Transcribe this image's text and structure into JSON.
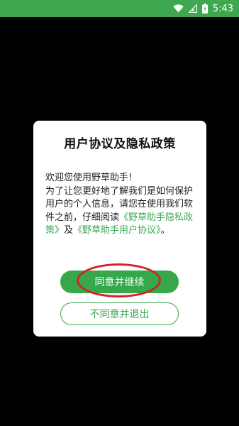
{
  "status_bar": {
    "time": "5:43",
    "wifi_icon": "wifi-icon",
    "signal_icon": "cell-signal-icon",
    "battery_icon": "battery-charging-icon",
    "background_color": "#3da84f"
  },
  "dialog": {
    "title": "用户协议及隐私政策",
    "welcome": "欢迎您使用野草助手!",
    "body_text": "为了让您更好地了解我们是如何保护用户的个人信息，请您在使用我们软件之前，仔细阅读",
    "privacy_link": "《野草助手隐私政策》",
    "and_text": "及",
    "agreement_link": "《野草助手用户协议》",
    "end_punct": "。",
    "agree_label": "同意并继续",
    "disagree_label": "不同意并退出",
    "accent_color": "#36a84b",
    "annotation_color": "#d4202a"
  }
}
